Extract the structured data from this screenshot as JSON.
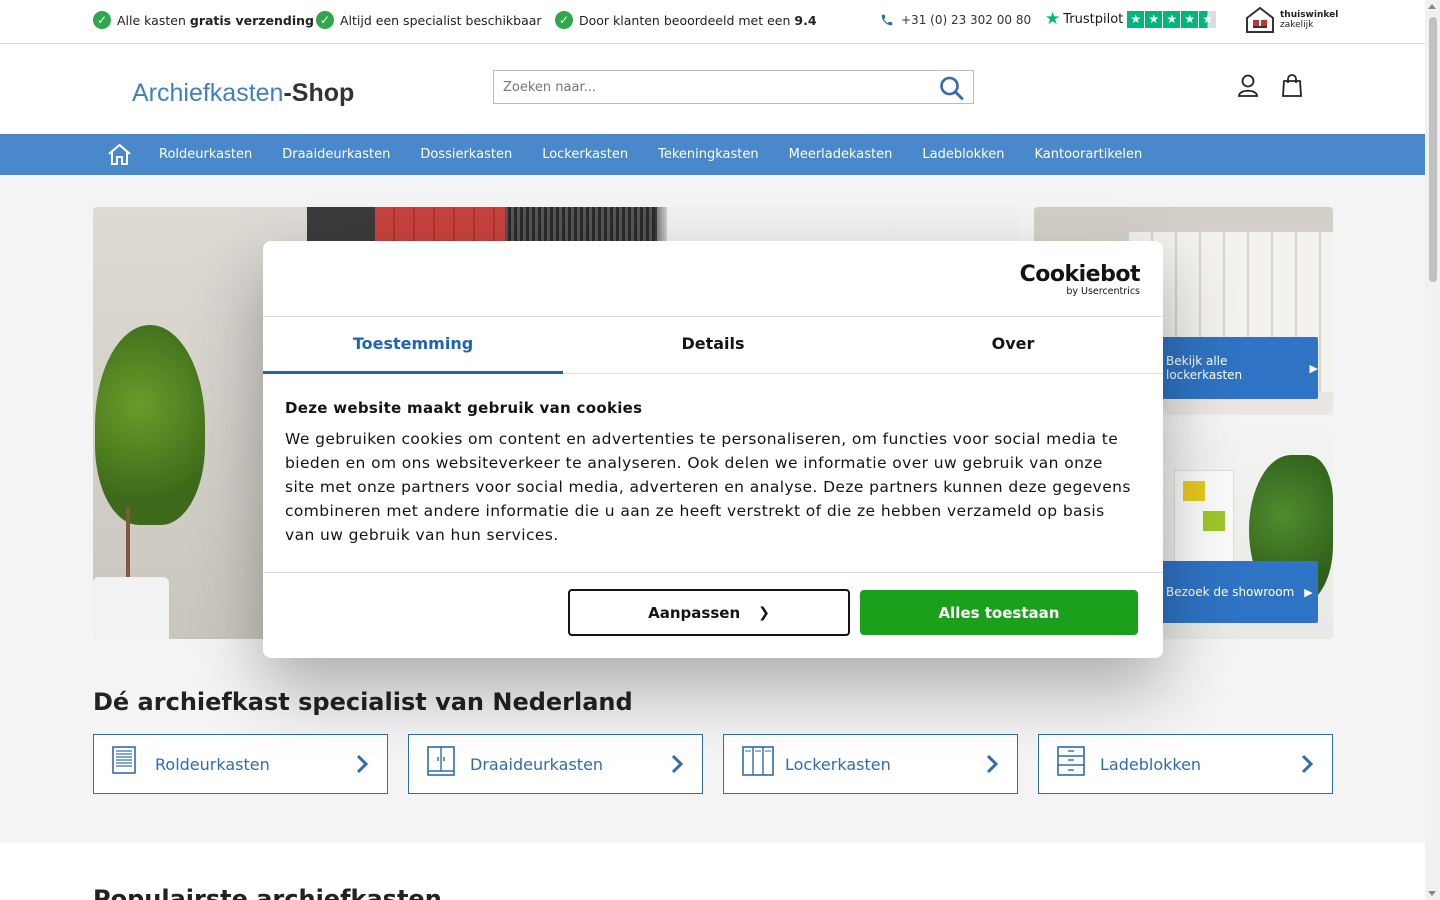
{
  "topbar": {
    "usps": [
      {
        "text_before": "Alle kasten ",
        "bold": "gratis verzending",
        "text_after": ""
      },
      {
        "text_before": "Altijd een specialist beschikbaar",
        "bold": "",
        "text_after": ""
      },
      {
        "text_before": "Door klanten beoordeeld met een ",
        "bold": "9.4",
        "text_after": ""
      }
    ],
    "phone": "+31 (0) 23 302 00 80",
    "trustpilot_label": "Trustpilot",
    "trustpilot_rating_stars": 4.5,
    "thuiswinkel_name": "thuiswinkel",
    "thuiswinkel_sub": "zakelijk"
  },
  "header": {
    "logo_part1": "Archiefkasten",
    "logo_part2": "-Shop",
    "search_placeholder": "Zoeken naar..."
  },
  "nav": {
    "items": [
      "Roldeurkasten",
      "Draaideurkasten",
      "Dossierkasten",
      "Lockerkasten",
      "Tekeningkasten",
      "Meerladekasten",
      "Ladeblokken",
      "Kantoorartikelen"
    ]
  },
  "hero": {
    "side1_button": "Bekijk alle lockerkasten",
    "side2_button": "Bezoek de showroom"
  },
  "specialist": {
    "title": "Dé archiefkast specialist van Nederland",
    "categories": [
      "Roldeurkasten",
      "Draaideurkasten",
      "Lockerkasten",
      "Ladeblokken"
    ]
  },
  "popular": {
    "title": "Populairste archiefkasten"
  },
  "cookie": {
    "brand": "Cookiebot",
    "brand_sub": "by Usercentrics",
    "tabs": [
      "Toestemming",
      "Details",
      "Over"
    ],
    "heading": "Deze website maakt gebruik van cookies",
    "body": "We gebruiken cookies om content en advertenties te personaliseren, om functies voor social media te bieden en om ons websiteverkeer te analyseren. Ook delen we informatie over uw gebruik van onze site met onze partners voor social media, adverteren en analyse. Deze partners kunnen deze gegevens combineren met andere informatie die u aan ze heeft verstrekt of die ze hebben verzameld op basis van uw gebruik van hun services.",
    "customize_label": "Aanpassen",
    "allow_label": "Alles toestaan",
    "colors": {
      "accent": "#1d63b8",
      "allow": "#1aa01a"
    }
  },
  "colors": {
    "nav_bg": "#4a88cc",
    "brand_blue": "#3f7fc4",
    "link_blue": "#2f6bb7",
    "check_green": "#2ea84a",
    "trustpilot_green": "#00b67a"
  }
}
